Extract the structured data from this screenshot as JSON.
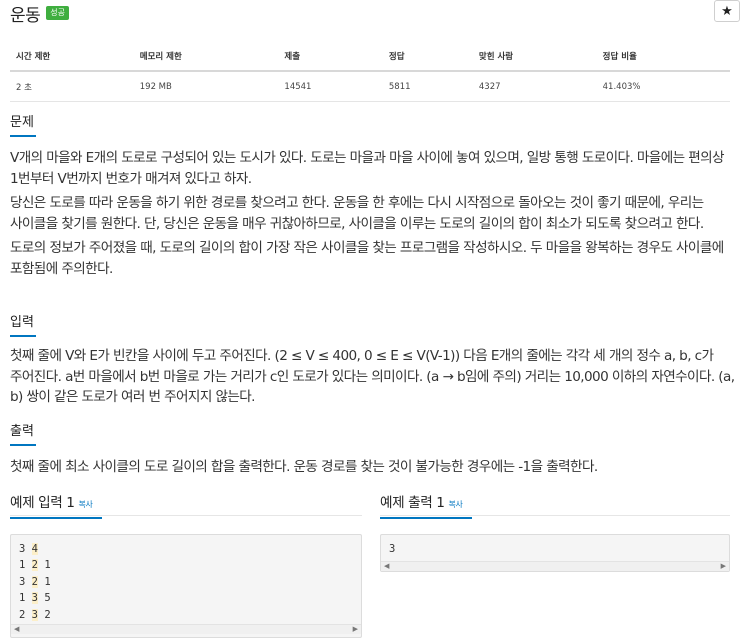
{
  "header": {
    "title": "운동",
    "badge": "성공",
    "star": "★"
  },
  "info_table": {
    "columns": [
      "시간 제한",
      "메모리 제한",
      "제출",
      "정답",
      "맞힌 사람",
      "정답 비율"
    ],
    "row": [
      "2 초",
      "192 MB",
      "14541",
      "5811",
      "4327",
      "41.403%"
    ]
  },
  "problem": {
    "heading": "문제",
    "paragraphs": [
      "V개의 마을와 E개의 도로로 구성되어 있는 도시가 있다. 도로는 마을과 마을 사이에 놓여 있으며, 일방 통행 도로이다. 마을에는 편의상 1번부터 V번까지 번호가 매겨져 있다고 하자.",
      "당신은 도로를 따라 운동을 하기 위한 경로를 찾으려고 한다. 운동을 한 후에는 다시 시작점으로 돌아오는 것이 좋기 때문에, 우리는 사이클을 찾기를 원한다. 단, 당신은 운동을 매우 귀찮아하므로, 사이클을 이루는 도로의 길이의 합이 최소가 되도록 찾으려고 한다.",
      "도로의 정보가 주어졌을 때, 도로의 길이의 합이 가장 작은 사이클을 찾는 프로그램을 작성하시오. 두 마을을 왕복하는 경우도 사이클에 포함됨에 주의한다."
    ]
  },
  "input": {
    "heading": "입력",
    "text": "첫째 줄에 V와 E가 빈칸을 사이에 두고 주어진다. (2 ≤ V ≤ 400, 0 ≤ E ≤ V(V-1)) 다음 E개의 줄에는 각각 세 개의 정수 a, b, c가 주어진다. a번 마을에서 b번 마을로 가는 거리가 c인 도로가 있다는 의미이다. (a → b임에 주의) 거리는 10,000 이하의 자연수이다. (a, b) 쌍이 같은 도로가 여러 번 주어지지 않는다."
  },
  "output": {
    "heading": "출력",
    "text": "첫째 줄에 최소 사이클의 도로 길이의 합을 출력한다. 운동 경로를 찾는 것이 불가능한 경우에는 -1을 출력한다."
  },
  "sample_input": {
    "heading": "예제 입력 1",
    "copy": "복사",
    "lines": [
      [
        "3",
        "4"
      ],
      [
        "1",
        "2",
        "1"
      ],
      [
        "3",
        "2",
        "1"
      ],
      [
        "1",
        "3",
        "5"
      ],
      [
        "2",
        "3",
        "2"
      ]
    ]
  },
  "sample_output": {
    "heading": "예제 출력 1",
    "copy": "복사",
    "lines": [
      "3"
    ]
  },
  "scroll_arrows": {
    "left": "◀",
    "right": "▶"
  },
  "colors": {
    "accent": "#0076c0",
    "badge": "#3fae3f",
    "code_bg": "#f5f5f5",
    "highlight": "#fcefc9"
  }
}
